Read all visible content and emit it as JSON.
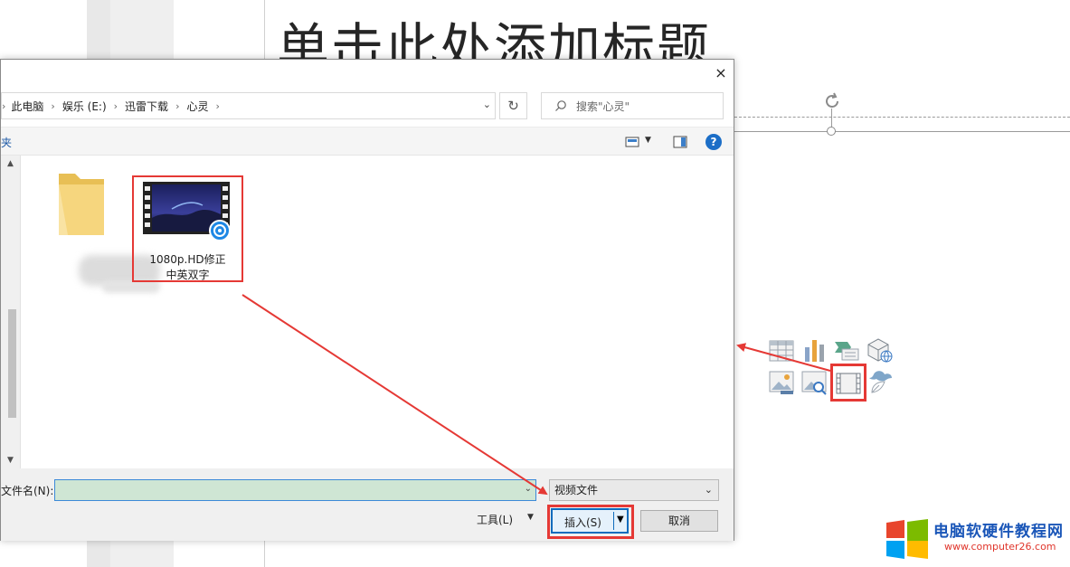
{
  "slide": {
    "title_placeholder": "单击此处添加标题"
  },
  "dialog": {
    "close_glyph": "×",
    "address_bar": {
      "crumbs": [
        "此电脑",
        "娱乐 (E:)",
        "迅雷下载",
        "心灵"
      ]
    },
    "search_placeholder": "搜索\"心灵\"",
    "toolbar": {
      "new_folder_partial": "夹"
    },
    "files": [
      {
        "type": "folder",
        "name_hidden": true
      },
      {
        "type": "video",
        "name": "1080p.HD修正中英双字",
        "name_lines": [
          "1080p.HD修正",
          "中英双字"
        ],
        "selected": true
      }
    ],
    "filename_label": "文件名(N):",
    "filename_value": "",
    "filetype_selected": "视频文件",
    "tools_label": "工具(L)",
    "insert_label": "插入(S)",
    "cancel_label": "取消"
  },
  "insert_icons": [
    "table-icon",
    "chart-icon",
    "smartart-icon",
    "3d-model-icon",
    "picture-icon",
    "online-picture-icon",
    "video-icon",
    "icons-icon"
  ],
  "watermark": {
    "title": "电脑软硬件教程网",
    "url": "www.computer26.com"
  },
  "colors": {
    "annotation_red": "#e53935",
    "accent_blue": "#0f6cbd",
    "filename_bg": "#cfe6d4"
  }
}
